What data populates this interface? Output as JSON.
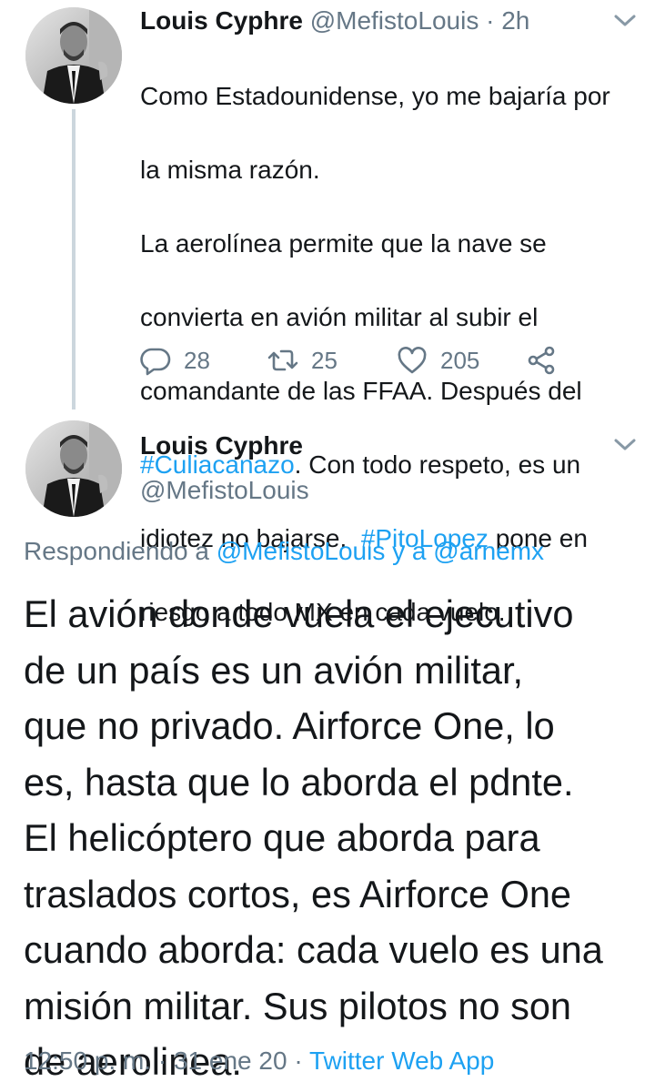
{
  "tweet1": {
    "name": "Louis Cyphre",
    "handle": "@MefistoLouis",
    "separator": "·",
    "time": "2h",
    "text_line1": "Como Estadounidense, yo me bajaría por",
    "text_line2": "la misma razón.",
    "text_line3": "La aerolínea  permite que la nave se",
    "text_line4": "convierta en avión militar al subir el",
    "text_line5": "comandante de las FFAA. Después del",
    "hashtag1": "#Culiacanazo",
    "text_after_hashtag1": ". Con todo respeto, es un",
    "text_line7_before": "idiotez no bajarse.  ",
    "hashtag2": "#PitoLopez",
    "text_line7_after": " pone en",
    "text_line8": "riesgo a todo MX en cada vuelo.",
    "actions": {
      "replies": "28",
      "retweets": "25",
      "likes": "205"
    }
  },
  "tweet2": {
    "name": "Louis Cyphre",
    "handle": "@MefistoLouis",
    "replying_prefix": "Respondiendo a ",
    "replying_user1": "@MefistoLouis",
    "replying_conjunction": " y a ",
    "replying_user2": "@arnemx",
    "lines": [
      "El avión donde vuela el ejecutivo",
      "de un país es un avión militar,",
      "que no privado. Airforce One, lo",
      "es, hasta que lo aborda el pdnte.",
      "El helicóptero que aborda para",
      "traslados cortos, es Airforce One",
      "cuando aborda: cada vuelo es una",
      "misión militar. Sus pilotos no son",
      "de aerolinea."
    ],
    "time": "12:50 p. m.",
    "separator": " · ",
    "date": "31 ene 20",
    "separator2": " · ",
    "source": "Twitter Web App"
  },
  "icons": {
    "reply": "reply-icon",
    "retweet": "retweet-icon",
    "like": "heart-icon",
    "share": "share-icon",
    "caret": "chevron-down-icon"
  },
  "colors": {
    "link": "#1da1f2",
    "muted": "#657786",
    "text": "#14171a",
    "thread_line": "#ccd6dd"
  }
}
